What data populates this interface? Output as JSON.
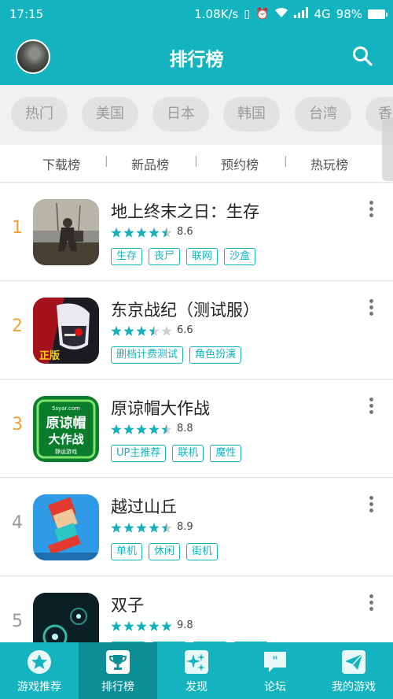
{
  "status_bar": {
    "time": "17:15",
    "speed": "1.08K/s",
    "network": "4G",
    "battery": "98%",
    "battery_level": 0.98
  },
  "header": {
    "title": "排行榜"
  },
  "region_tabs": [
    "热门",
    "美国",
    "日本",
    "韩国",
    "台湾",
    "香"
  ],
  "active_region": "热门",
  "sub_tabs": [
    "下载榜",
    "新品榜",
    "预约榜",
    "热玩榜"
  ],
  "active_sub_tab": "下载榜",
  "apps": [
    {
      "rank": "1",
      "name": "地上终末之日：生存",
      "rating": "8.6",
      "stars": 4.5,
      "tags": [
        "生存",
        "丧尸",
        "联网",
        "沙盒"
      ]
    },
    {
      "rank": "2",
      "name": "东京战纪（测试服）",
      "rating": "6.6",
      "stars": 3.5,
      "tags": [
        "删档计费测试",
        "角色扮演"
      ]
    },
    {
      "rank": "3",
      "name": "原谅帽大作战",
      "rating": "8.8",
      "stars": 4.5,
      "tags": [
        "UP主推荐",
        "联机",
        "魔性"
      ]
    },
    {
      "rank": "4",
      "name": "越过山丘",
      "rating": "8.9",
      "stars": 4.5,
      "tags": [
        "单机",
        "休闲",
        "街机"
      ]
    },
    {
      "rank": "5",
      "name": "双子",
      "rating": "9.8",
      "stars": 5,
      "tags": [
        "",
        "",
        "",
        ""
      ]
    }
  ],
  "icon_texts": {
    "app2_badge": "正版",
    "app3_line1": "原谅帽",
    "app3_line2": "大作战",
    "app3_top": "5syar.com",
    "app3_bottom": "静运游戏"
  },
  "bottom_nav": [
    {
      "label": "游戏推荐",
      "icon": "star-icon"
    },
    {
      "label": "排行榜",
      "icon": "trophy-icon"
    },
    {
      "label": "发现",
      "icon": "sparkle-icon"
    },
    {
      "label": "论坛",
      "icon": "chat-icon"
    },
    {
      "label": "我的游戏",
      "icon": "paper-plane-icon"
    }
  ],
  "colors": {
    "accent": "#13b3bf",
    "accent_dark": "#0d8f98",
    "rank_top": "#f2a233",
    "star": "#13b3bf"
  }
}
